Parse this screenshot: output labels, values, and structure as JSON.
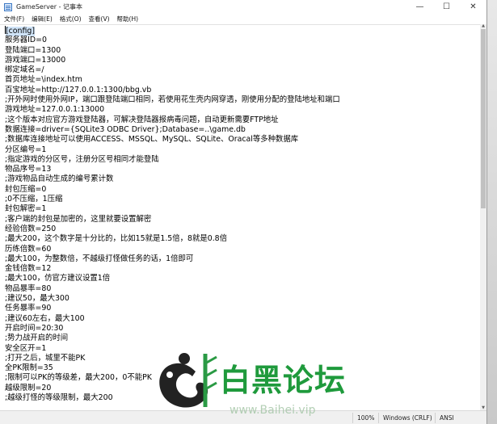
{
  "window": {
    "title": "GameServer - 记事本",
    "controls": {
      "minimize": "—",
      "maximize": "☐",
      "close": "✕"
    }
  },
  "menu": [
    "文件(F)",
    "编辑(E)",
    "格式(O)",
    "查看(V)",
    "帮助(H)"
  ],
  "editor": {
    "lines": [
      "[config]",
      "服务器ID=0",
      "登陆端口=1300",
      "游戏端口=13000",
      "绑定域名=/",
      "首页地址=\\index.htm",
      "百宝地址=http://127.0.0.1:1300/bbg.vb",
      ";开外网时使用外网IP，端口跟登陆端口相同，若使用花生壳内网穿透，刚使用分配的登陆地址和端口",
      "游戏地址=127.0.0.1:13000",
      ";这个版本对应官方游戏登陆器，可解决登陆器报病毒问题，自动更新需要FTP地址",
      "数据连接=driver={SQLite3 ODBC Driver};Database=..\\game.db",
      ";数据库连接地址可以使用ACCESS、MSSQL、MySQL、SQLite、Oracal等多种数据库",
      "分区编号=1",
      ";指定游戏的分区号，注册分区号相同才能登陆",
      "物品序号=13",
      ";游戏物品自动生成的编号累计数",
      "封包压缩=0",
      ";0不压缩，1压缩",
      "封包解密=1",
      ";客户端的封包是加密的，这里就要设置解密",
      "经验倍数=250",
      ";最大200，这个数字是十分比的，比如15就是1.5倍，8就是0.8倍",
      "历练倍数=60",
      ";最大100，为整数倍，不越级打怪做任务的话，1倍即可",
      "金钱倍数=12",
      ";最大100，仿官方建议设置1倍",
      "物品暴率=80",
      ";建议50，最大300",
      "任务暴率=90",
      ";建议60左右，最大100",
      "开启时间=20:30",
      ";势力战开启的时间",
      "安全区开=1",
      ";打开之后，城里不能PK",
      "全PK限制=35",
      ";限制可以PK的等级差，最大200，0不能PK",
      "越级限制=20",
      ";越级打怪的等级限制，最大200"
    ]
  },
  "statusbar": {
    "zoom": "100%",
    "line_ending": "Windows (CRLF)",
    "encoding": "ANSI"
  },
  "watermark": {
    "text": "白黑论坛",
    "url": "www.Baihei.vip"
  },
  "colors": {
    "selection": "#cfe3f7",
    "watermark_green": "#1f9a3c"
  }
}
